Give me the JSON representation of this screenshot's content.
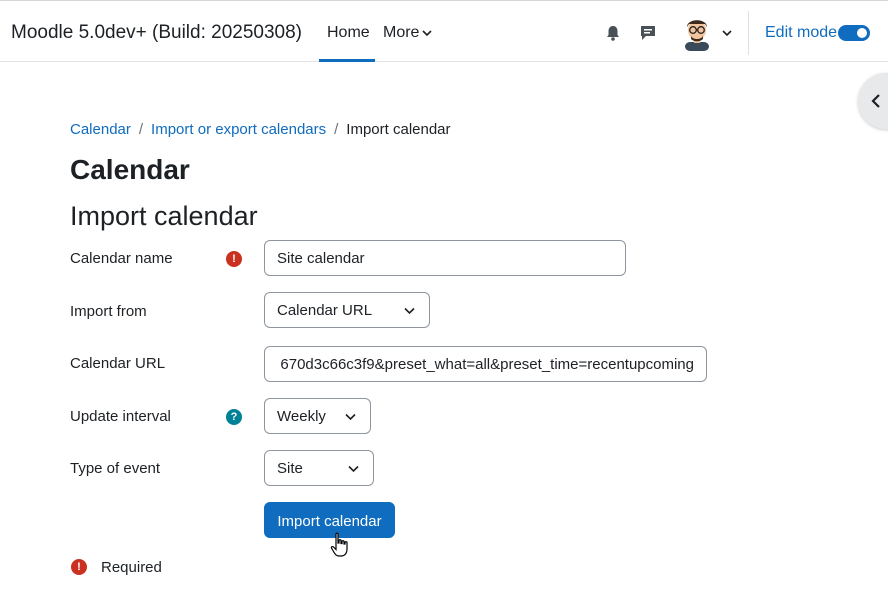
{
  "header": {
    "site_name": "Moodle 5.0dev+ (Build: 20250308)",
    "nav": {
      "home": "Home",
      "more": "More"
    },
    "edit_mode_label": "Edit mode",
    "edit_mode_on": true
  },
  "breadcrumb": {
    "items": [
      "Calendar",
      "Import or export calendars"
    ],
    "current": "Import calendar"
  },
  "page": {
    "title": "Calendar",
    "section_title": "Import calendar"
  },
  "form": {
    "calendar_name": {
      "label": "Calendar name",
      "value": "Site calendar"
    },
    "import_from": {
      "label": "Import from",
      "value": "Calendar URL"
    },
    "calendar_url": {
      "label": "Calendar URL",
      "value": "670d3c66c3f9&preset_what=all&preset_time=recentupcoming"
    },
    "update_interval": {
      "label": "Update interval",
      "value": "Weekly"
    },
    "event_type": {
      "label": "Type of event",
      "value": "Site"
    },
    "submit_label": "Import calendar",
    "required_note": "Required"
  },
  "icons": {
    "required_glyph": "!",
    "help_glyph": "?"
  },
  "colors": {
    "accent": "#0f6cbf",
    "required": "#ca3120",
    "help": "#008196"
  }
}
